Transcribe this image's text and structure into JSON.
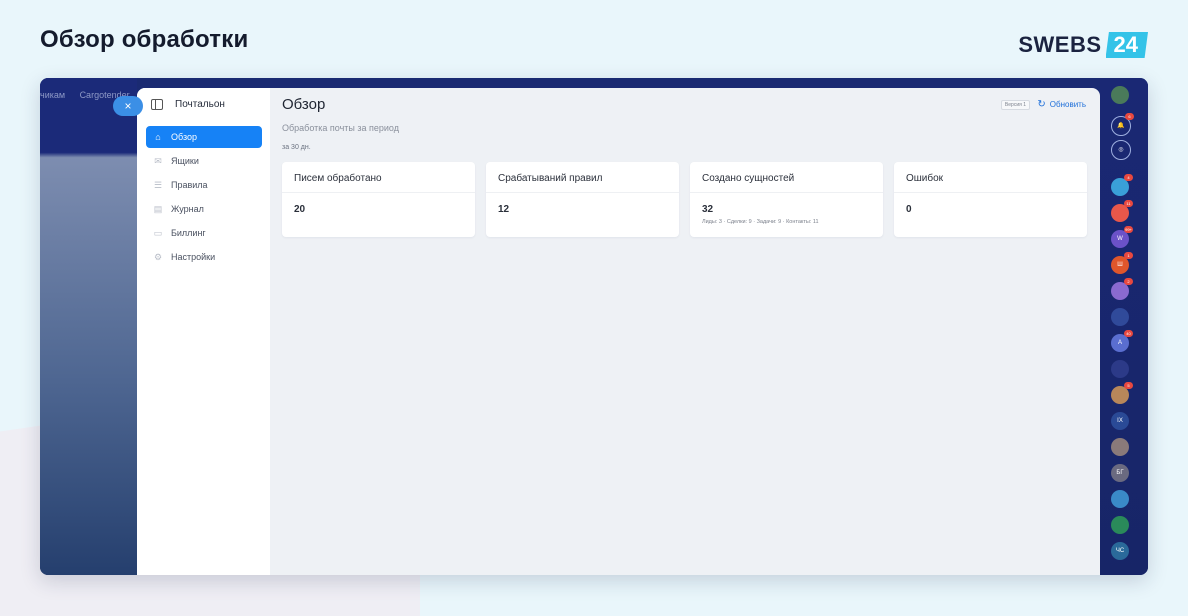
{
  "page_heading": "Обзор обработки",
  "brand": {
    "name": "SWEBS",
    "number": "24",
    "accent": "#34c3e8"
  },
  "background_tabs": [
    "чикам",
    "Cargotender"
  ],
  "close_icon": "×",
  "app": {
    "name": "Почтальон",
    "nav": [
      {
        "label": "Обзор",
        "icon": "home-icon",
        "active": true
      },
      {
        "label": "Ящики",
        "icon": "mail-icon",
        "active": false
      },
      {
        "label": "Правила",
        "icon": "list-icon",
        "active": false
      },
      {
        "label": "Журнал",
        "icon": "journal-icon",
        "active": false
      },
      {
        "label": "Биллинг",
        "icon": "wallet-icon",
        "active": false
      },
      {
        "label": "Настройки",
        "icon": "gear-icon",
        "active": false
      }
    ]
  },
  "main": {
    "title": "Обзор",
    "subtitle": "Обработка почты за период",
    "period": "за 30 дн.",
    "version": "Версия 1",
    "refresh_label": "Обновить"
  },
  "cards": [
    {
      "title": "Писем обработано",
      "value": "20",
      "note": ""
    },
    {
      "title": "Срабатываний правил",
      "value": "12",
      "note": ""
    },
    {
      "title": "Создано сущностей",
      "value": "32",
      "note": "Лиды: 3 · Сделки: 9 · Задачи: 9 · Контакты: 11"
    },
    {
      "title": "Ошибок",
      "value": "0",
      "note": ""
    }
  ],
  "rail": [
    {
      "name": "avatar",
      "label": "",
      "badge": "",
      "color": "#4a7a5a"
    },
    {
      "name": "bell-icon",
      "label": "🔔",
      "badge": "6",
      "color": "transparent"
    },
    {
      "name": "chat-icon",
      "label": "◎",
      "badge": "",
      "color": "transparent"
    },
    {
      "name": "app-1",
      "label": "",
      "badge": "4",
      "color": "#3aa0d8"
    },
    {
      "name": "app-2",
      "label": "",
      "badge": "11",
      "color": "#e8574a"
    },
    {
      "name": "app-3",
      "label": "W",
      "badge": "99+",
      "color": "#6b52c8"
    },
    {
      "name": "app-4",
      "label": "Ш",
      "badge": "1",
      "color": "#e0562b"
    },
    {
      "name": "app-5",
      "label": "",
      "badge": "2",
      "color": "#8a6ad0"
    },
    {
      "name": "app-6",
      "label": "",
      "badge": "",
      "color": "#304a9a"
    },
    {
      "name": "app-7",
      "label": "A",
      "badge": "40",
      "color": "#5a6ed0"
    },
    {
      "name": "app-8",
      "label": "",
      "badge": "",
      "color": "#2c3a88"
    },
    {
      "name": "app-9",
      "label": "",
      "badge": "5",
      "color": "#b8875a"
    },
    {
      "name": "app-10",
      "label": "IX",
      "badge": "",
      "color": "#2a4a96"
    },
    {
      "name": "app-11",
      "label": "",
      "badge": "",
      "color": "#8a7a7a"
    },
    {
      "name": "app-12",
      "label": "БГ",
      "badge": "",
      "color": "#6a6a80"
    },
    {
      "name": "app-13",
      "label": "",
      "badge": "",
      "color": "#3a8ac8"
    },
    {
      "name": "app-14",
      "label": "",
      "badge": "",
      "color": "#2a8a5a"
    },
    {
      "name": "app-15",
      "label": "ЧС",
      "badge": "",
      "color": "#2a6a9a"
    }
  ]
}
